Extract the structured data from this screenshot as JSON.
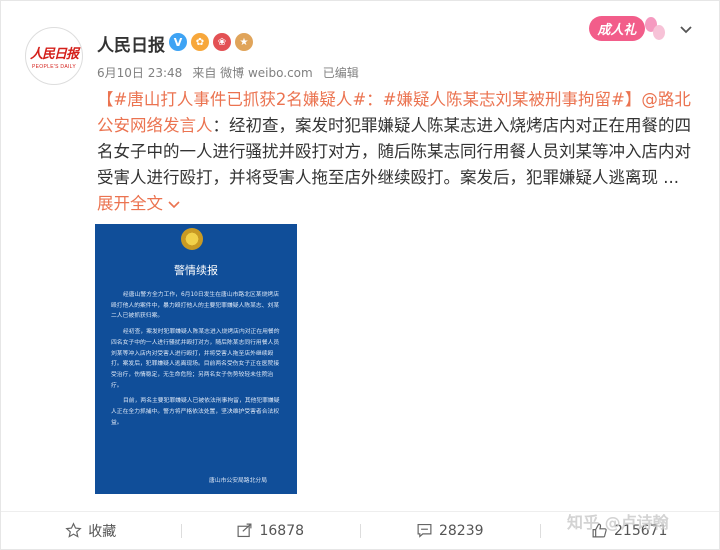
{
  "post": {
    "author": "人民日报",
    "logo_text": "人民日报",
    "logo_sub": "PEOPLE'S DAILY",
    "date": "6月10日 23:48",
    "source_prefix": "来自",
    "source": "微博 weibo.com",
    "edited": "已编辑",
    "promo_label": "成人礼",
    "text": {
      "topic1": "【#唐山打人事件已抓获2名嫌疑人#",
      "colon": "：",
      "topic2": "#嫌疑人陈某志刘某被刑事拘留#",
      "close_bracket": "】",
      "mention": "@路北公安网络发言人",
      "body": "：经初查，案发时犯罪嫌疑人陈某志进入烧烤店内对正在用餐的四名女子中的一人进行骚扰并殴打对方，随后陈某志同行用餐人员刘某等冲入店内对受害人进行殴打，并将受害人拖至店外继续殴打。案发后，犯罪嫌疑人逃离现",
      "ellipsis": " ... ",
      "expand": "展开全文"
    },
    "notice": {
      "title": "警情续报",
      "p1": "经唐山警方全力工作，6月10日发生在唐山市路北区某烧烤店殴打他人的案件中，暴力殴打他人的主要犯罪嫌疑人陈某志、刘某二人已被抓获归案。",
      "p2": "经初查，案发时犯罪嫌疑人陈某志进入烧烤店内对正在用餐的四名女子中的一人进行骚扰并殴打对方，随后陈某志同行用餐人员刘某等冲入店内对受害人进行殴打，并将受害人拖至店外继续殴打。案发后，犯罪嫌疑人逃离现场。目前两名受伤女子正在医院接受治疗，伤情稳定，无生命危险；另两名女子伤势较轻未住院治疗。",
      "p3": "目前，两名主要犯罪嫌疑人已被依法刑事拘留，其他犯罪嫌疑人正在全力抓捕中。警方将严格依法处置，坚决维护受害者合法权益。",
      "sign": "唐山市公安局路北分局"
    }
  },
  "actions": {
    "favorite": "收藏",
    "repost": "16878",
    "comment": "28239",
    "like": "215671"
  },
  "watermark": "知乎 @卢诗翰",
  "colors": {
    "accent": "#eb7350",
    "notice_bg": "#104e99"
  },
  "icons": [
    "star-icon",
    "repost-icon",
    "comment-icon",
    "like-icon",
    "chevron-down-icon"
  ]
}
